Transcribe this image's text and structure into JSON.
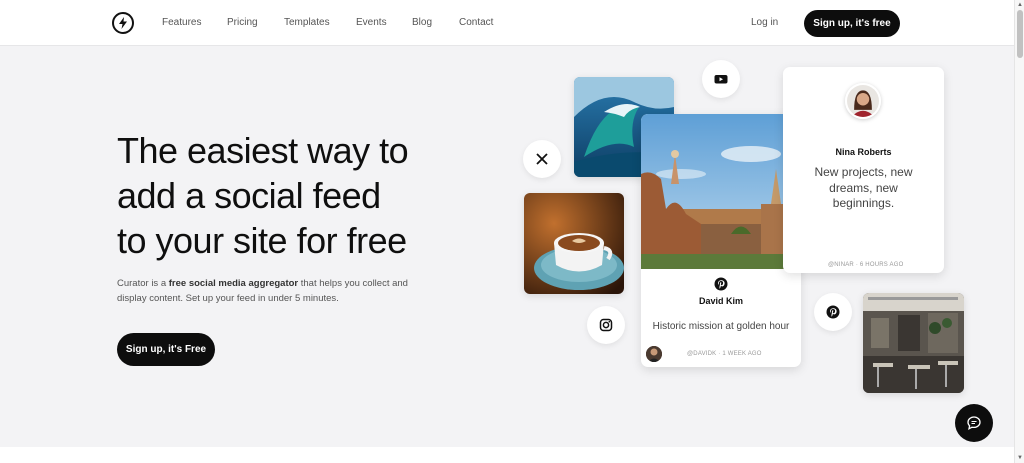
{
  "nav": {
    "logo_icon": "lightning-bolt-logo",
    "links": [
      "Features",
      "Pricing",
      "Templates",
      "Events",
      "Blog",
      "Contact"
    ],
    "login": "Log in",
    "signup": "Sign up, it's free"
  },
  "hero": {
    "title_lines": [
      "The easiest way to",
      "add a social feed",
      "to your site for free"
    ],
    "desc_pre": "Curator is a ",
    "desc_bold": "free social media aggregator",
    "desc_post": " that helps you collect and display content. Set up your feed in under 5 minutes.",
    "cta": "Sign up, it's Free"
  },
  "feed": {
    "card_nina": {
      "name": "Nina Roberts",
      "text": "New projects, new dreams, new beginnings.",
      "meta": "@NINAR · 6 HOURS AGO"
    },
    "card_david": {
      "name": "David Kim",
      "text": "Historic mission at golden hour",
      "meta": "@DAVIDK · 1 WEEK AGO"
    }
  },
  "colors": {
    "accent": "#0d0d0d",
    "background": "#f3f3f5"
  }
}
